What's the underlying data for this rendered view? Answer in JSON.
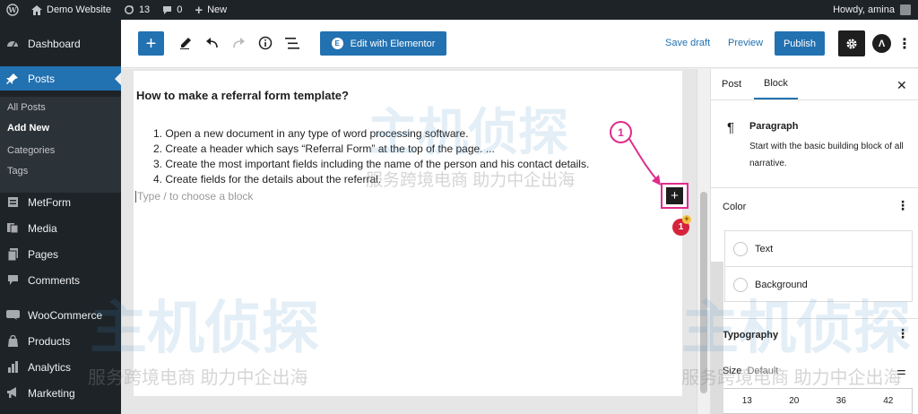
{
  "adminbar": {
    "site_name": "Demo Website",
    "updates_count": "13",
    "comments_count": "0",
    "new_label": "New",
    "greeting": "Howdy, amina"
  },
  "sidebar": {
    "items": [
      {
        "label": "Dashboard",
        "icon": "dashboard-icon"
      },
      {
        "label": "Posts",
        "icon": "pin-icon"
      },
      {
        "label": "MetForm",
        "icon": "form-icon"
      },
      {
        "label": "Media",
        "icon": "media-icon"
      },
      {
        "label": "Pages",
        "icon": "page-icon"
      },
      {
        "label": "Comments",
        "icon": "comment-icon"
      },
      {
        "label": "WooCommerce",
        "icon": "woo-icon"
      },
      {
        "label": "Products",
        "icon": "products-icon"
      },
      {
        "label": "Analytics",
        "icon": "analytics-icon"
      },
      {
        "label": "Marketing",
        "icon": "megaphone-icon"
      }
    ],
    "submenu": [
      "All Posts",
      "Add New",
      "Categories",
      "Tags"
    ]
  },
  "toolbar": {
    "elementor_label": "Edit with Elementor",
    "save_draft": "Save draft",
    "preview": "Preview",
    "publish": "Publish"
  },
  "editor": {
    "heading": "How to make a referral form template?",
    "list": [
      "1. Open a new document in any type of word processing software.",
      "2. Create a header which says “Referral Form” at the top of the page. ...",
      "3. Create the most important fields including the name of the person and his contact details.",
      "4. Create fields for the details about the referral."
    ],
    "placeholder": "Type / to choose a block",
    "callout_number": "1",
    "badge_number": "1"
  },
  "panel": {
    "tabs": [
      "Post",
      "Block"
    ],
    "block_title": "Paragraph",
    "block_desc": "Start with the basic building block of all narrative.",
    "color_title": "Color",
    "color_text": "Text",
    "color_background": "Background",
    "typography_title": "Typography",
    "size_label": "Size",
    "size_value": "Default",
    "size_options": [
      "13",
      "20",
      "36",
      "42"
    ]
  },
  "watermark": {
    "main": "主机侦探",
    "sub": "服务跨境电商 助力中企出海"
  },
  "colors": {
    "admin_dark": "#1d2327",
    "accent_blue": "#2271b1",
    "annotation_pink": "#e02c8c",
    "badge_red": "#d6233b"
  }
}
